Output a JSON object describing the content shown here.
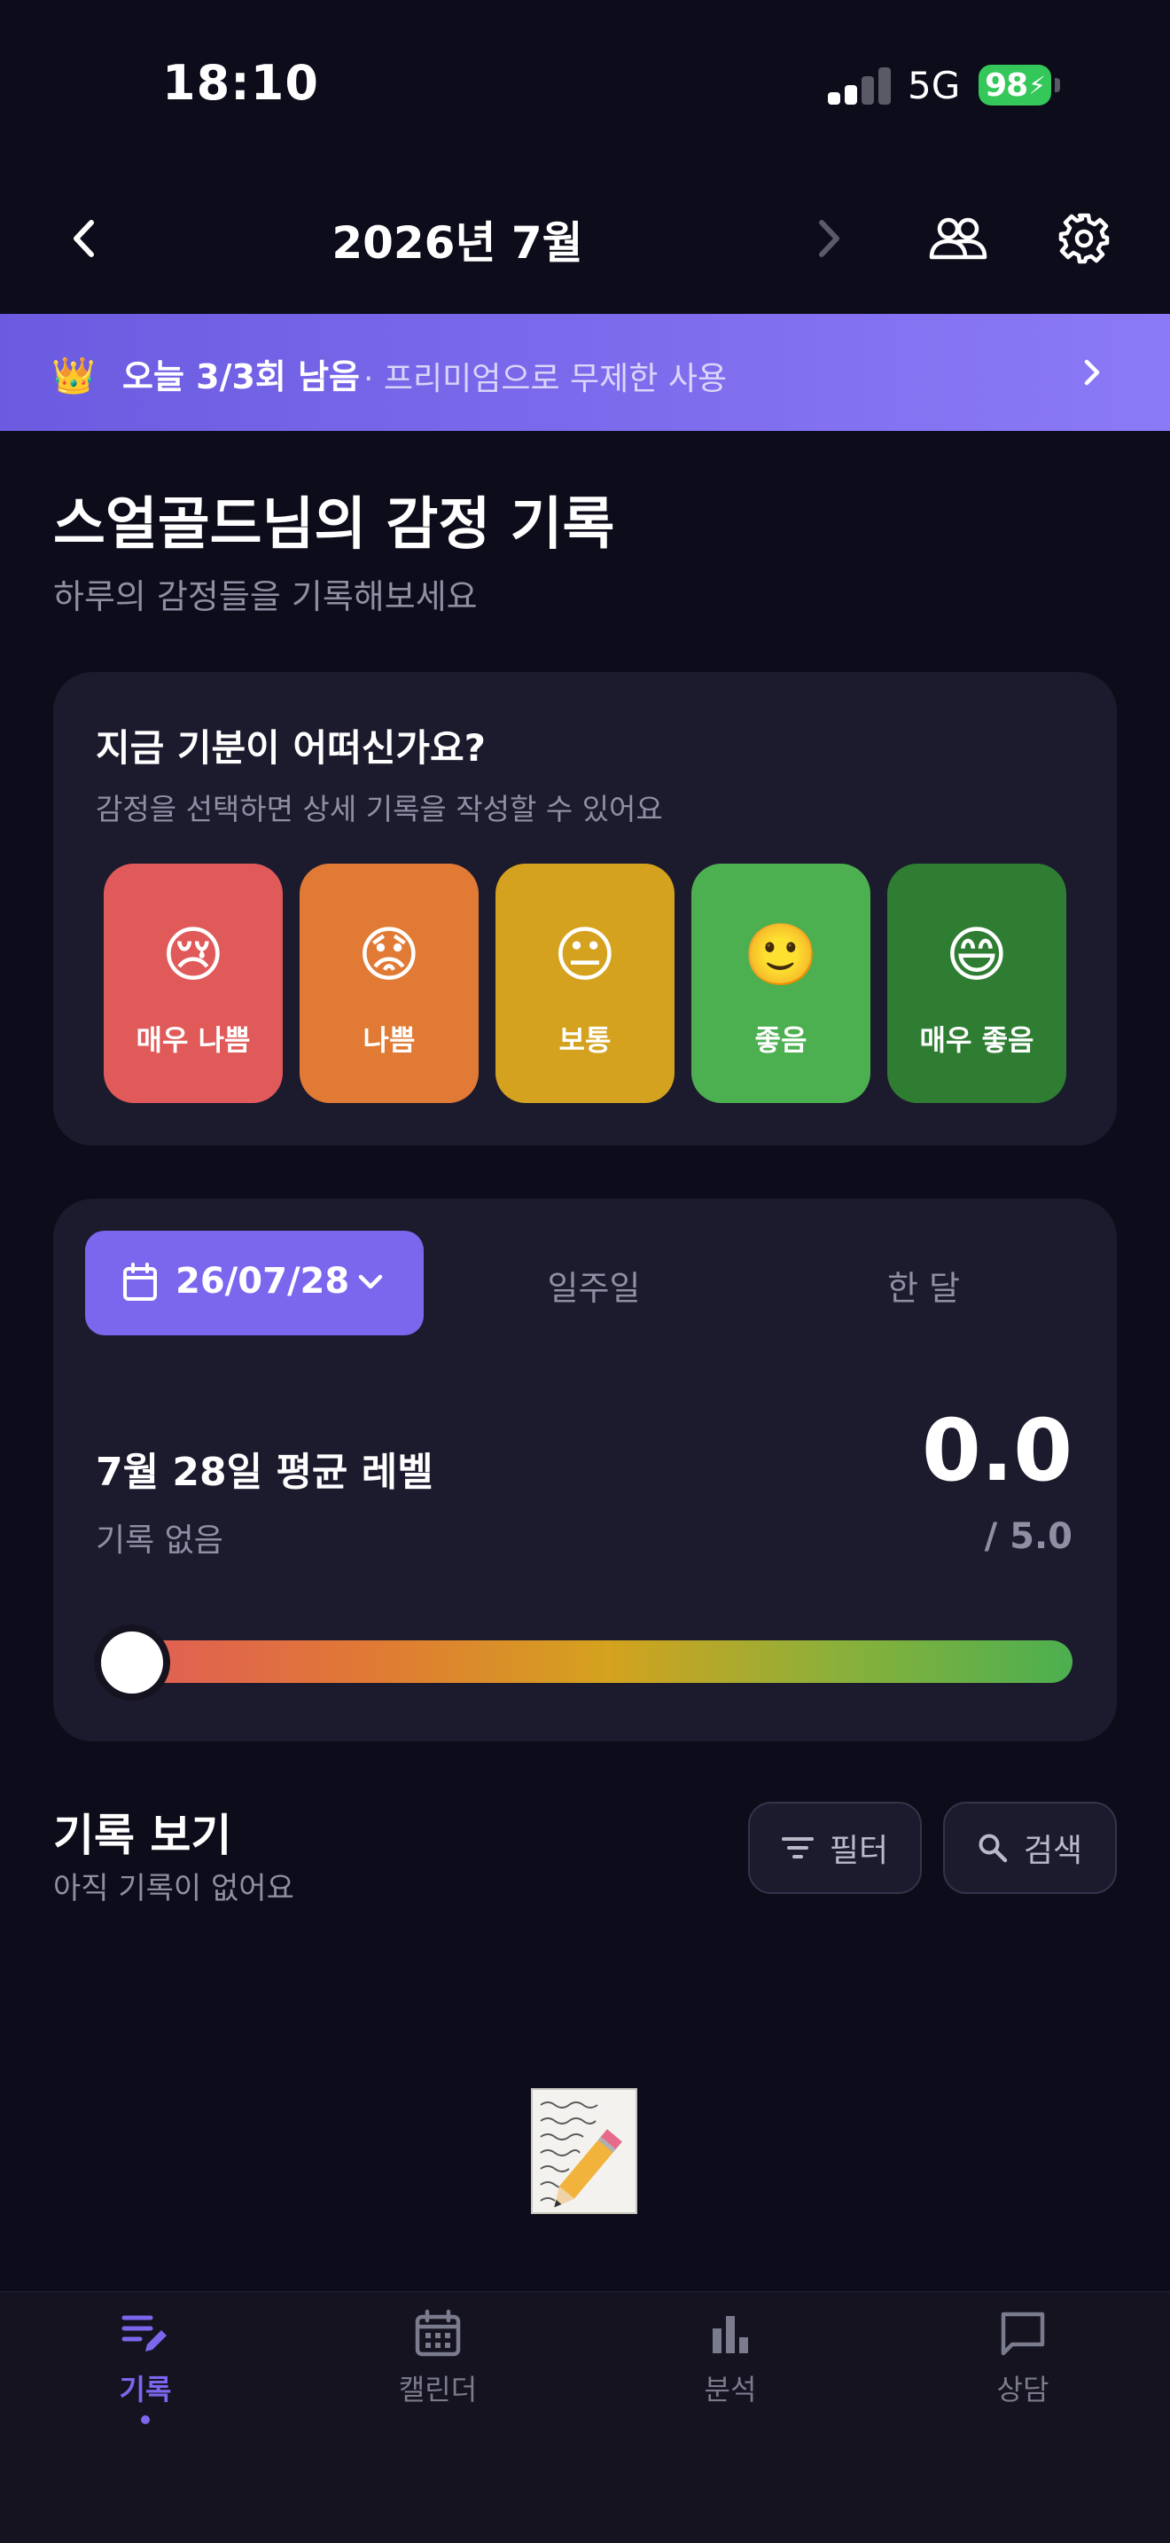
{
  "status_bar": {
    "time": "18:10",
    "network": "5G",
    "battery": "98"
  },
  "header": {
    "title": "2026년 7월",
    "icons": [
      "chevron-left-icon",
      "chevron-right-icon",
      "people-icon",
      "gear-icon"
    ]
  },
  "banner": {
    "main": "오늘 3/3회 남음",
    "sub": "· 프리미엄으로 무제한 사용",
    "icon": "crown-icon"
  },
  "greeting": {
    "title": "스얼골드님의 감정 기록",
    "subtitle": "하루의 감정들을 기록해보세요"
  },
  "mood_card": {
    "question": "지금 기분이 어떠신가요?",
    "hint": "감정을 선택하면 상세 기록을 작성할 수 있어요",
    "moods": [
      {
        "label": "매우 나쁨",
        "emoji": "😢",
        "color": "#e05a5a"
      },
      {
        "label": "나쁨",
        "emoji": "😟",
        "color": "#e07a34"
      },
      {
        "label": "보통",
        "emoji": "😐",
        "color": "#d4a21e"
      },
      {
        "label": "좋음",
        "emoji": "🙂",
        "color": "#4caf50"
      },
      {
        "label": "매우 좋음",
        "emoji": "😄",
        "color": "#2e7d32"
      }
    ]
  },
  "stats": {
    "date": "26/07/28",
    "tabs": [
      "일주일",
      "한 달"
    ],
    "avg_title": "7월 28일 평균 레벨",
    "avg_sub": "기록 없음",
    "avg_value": "0.0",
    "avg_max": "/ 5.0",
    "level_fraction": 0.0
  },
  "records": {
    "title": "기록 보기",
    "subtitle": "아직 기록이 없어요",
    "filter_label": "필터",
    "search_label": "검색",
    "empty_emoji": "📝"
  },
  "tab_bar": {
    "items": [
      {
        "label": "기록",
        "icon": "edit-list-icon",
        "active": true
      },
      {
        "label": "캘린더",
        "icon": "calendar-icon",
        "active": false
      },
      {
        "label": "분석",
        "icon": "bar-chart-icon",
        "active": false
      },
      {
        "label": "상담",
        "icon": "chat-bubble-icon",
        "active": false
      }
    ]
  },
  "colors": {
    "accent": "#7a67ee",
    "background": "#0c0c1a",
    "card": "#1c1b2e"
  }
}
